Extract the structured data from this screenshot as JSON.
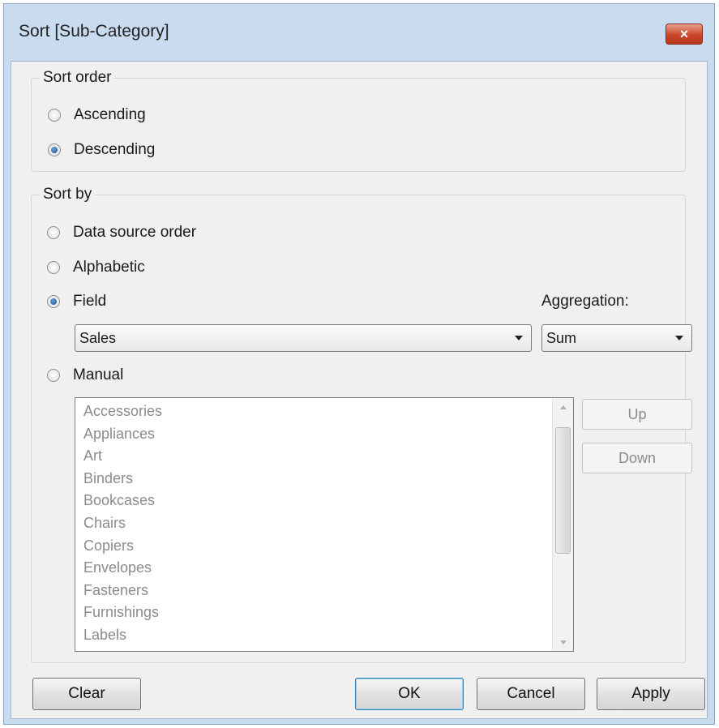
{
  "window": {
    "title": "Sort [Sub-Category]",
    "close_icon": "×"
  },
  "sort_order": {
    "legend": "Sort order",
    "options": [
      {
        "label": "Ascending",
        "checked": false
      },
      {
        "label": "Descending",
        "checked": true
      }
    ]
  },
  "sort_by": {
    "legend": "Sort by",
    "options": {
      "data_source_order": {
        "label": "Data source order",
        "checked": false
      },
      "alphabetic": {
        "label": "Alphabetic",
        "checked": false
      },
      "field": {
        "label": "Field",
        "checked": true
      },
      "manual": {
        "label": "Manual",
        "checked": false
      }
    },
    "field_select": {
      "value": "Sales"
    },
    "aggregation": {
      "label": "Aggregation:",
      "value": "Sum"
    },
    "manual_list": [
      "Accessories",
      "Appliances",
      "Art",
      "Binders",
      "Bookcases",
      "Chairs",
      "Copiers",
      "Envelopes",
      "Fasteners",
      "Furnishings",
      "Labels"
    ],
    "up_label": "Up",
    "down_label": "Down"
  },
  "footer": {
    "clear_label": "Clear",
    "ok_label": "OK",
    "cancel_label": "Cancel",
    "apply_label": "Apply"
  }
}
